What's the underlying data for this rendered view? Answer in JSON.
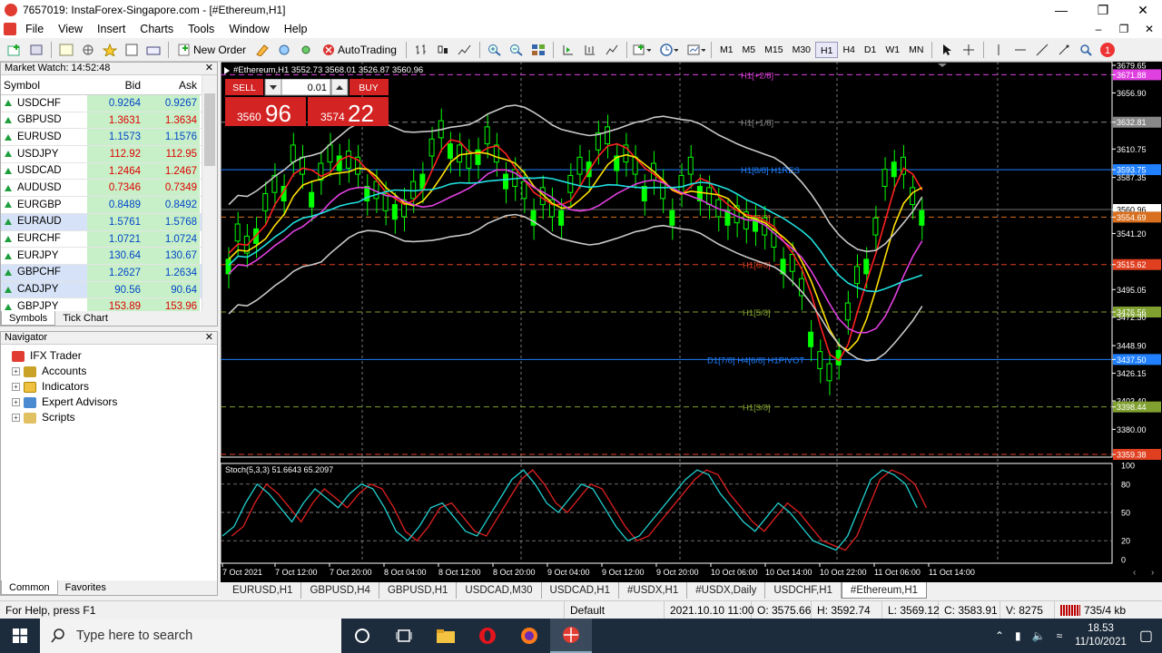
{
  "window": {
    "title": "7657019: InstaForex-Singapore.com - [#Ethereum,H1]"
  },
  "menu": [
    "File",
    "View",
    "Insert",
    "Charts",
    "Tools",
    "Window",
    "Help"
  ],
  "toolbar": {
    "new_order": "New Order",
    "autotrading": "AutoTrading",
    "timeframes": [
      "M1",
      "M5",
      "M15",
      "M30",
      "H1",
      "H4",
      "D1",
      "W1",
      "MN"
    ],
    "active_tf": "H1",
    "notify_count": "1"
  },
  "market_watch": {
    "title": "Market Watch: 14:52:48",
    "headers": [
      "Symbol",
      "Bid",
      "Ask"
    ],
    "rows": [
      {
        "symbol": "USDCHF",
        "bid": "0.9264",
        "ask": "0.9267",
        "color": "blue"
      },
      {
        "symbol": "GBPUSD",
        "bid": "1.3631",
        "ask": "1.3634",
        "color": "red"
      },
      {
        "symbol": "EURUSD",
        "bid": "1.1573",
        "ask": "1.1576",
        "color": "blue"
      },
      {
        "symbol": "USDJPY",
        "bid": "112.92",
        "ask": "112.95",
        "color": "red"
      },
      {
        "symbol": "USDCAD",
        "bid": "1.2464",
        "ask": "1.2467",
        "color": "red"
      },
      {
        "symbol": "AUDUSD",
        "bid": "0.7346",
        "ask": "0.7349",
        "color": "red"
      },
      {
        "symbol": "EURGBP",
        "bid": "0.8489",
        "ask": "0.8492",
        "color": "blue"
      },
      {
        "symbol": "EURAUD",
        "bid": "1.5761",
        "ask": "1.5768",
        "color": "blue"
      },
      {
        "symbol": "EURCHF",
        "bid": "1.0721",
        "ask": "1.0724",
        "color": "blue"
      },
      {
        "symbol": "EURJPY",
        "bid": "130.64",
        "ask": "130.67",
        "color": "blue"
      },
      {
        "symbol": "GBPCHF",
        "bid": "1.2627",
        "ask": "1.2634",
        "color": "blue"
      },
      {
        "symbol": "CADJPY",
        "bid": "90.56",
        "ask": "90.64",
        "color": "blue"
      },
      {
        "symbol": "GBPJPY",
        "bid": "153.89",
        "ask": "153.96",
        "color": "red"
      }
    ],
    "tabs": [
      "Symbols",
      "Tick Chart"
    ]
  },
  "navigator": {
    "title": "Navigator",
    "root": "IFX Trader",
    "items": [
      "Accounts",
      "Indicators",
      "Expert Advisors",
      "Scripts"
    ],
    "tabs": [
      "Common",
      "Favorites"
    ]
  },
  "chart": {
    "header": "#Ethereum,H1  3552.73 3568.01 3526.87 3560.96",
    "order": {
      "sell": "SELL",
      "buy": "BUY",
      "lots": "0.01",
      "sell_big": "96",
      "sell_small": "3560",
      "buy_big": "22",
      "buy_small": "3574"
    },
    "price_labels": [
      "3679.65",
      "3671.88",
      "3656.90",
      "3632.81",
      "3610.75",
      "3593.75",
      "3587.35",
      "3560.96",
      "3554.69",
      "3541.20",
      "3515.62",
      "3495.05",
      "3476.56",
      "3472.30",
      "3448.90",
      "3437.50",
      "3426.15",
      "3403.40",
      "3398.44",
      "3380.00",
      "3359.38"
    ],
    "murray": [
      "H1[+2/8]",
      "H1[+1/8]",
      "H1[8/8] H1RES",
      "H1[7/8]",
      "H1[6/8]",
      "H1[5/8]",
      "D1[7/8] H4[6/8] H1PIVOT",
      "H1[3/8]"
    ],
    "stoch_label": "Stoch(5,3,3) 51.6643 65.2097",
    "stoch_levels": [
      "100",
      "80",
      "50",
      "20",
      "0"
    ],
    "time_labels": [
      "7 Oct 2021",
      "7 Oct 12:00",
      "7 Oct 20:00",
      "8 Oct 04:00",
      "8 Oct 12:00",
      "8 Oct 20:00",
      "9 Oct 04:00",
      "9 Oct 12:00",
      "9 Oct 20:00",
      "10 Oct 06:00",
      "10 Oct 14:00",
      "10 Oct 22:00",
      "11 Oct 06:00",
      "11 Oct 14:00"
    ]
  },
  "chart_tabs": [
    "EURUSD,H1",
    "GBPUSD,H4",
    "GBPUSD,H1",
    "USDCAD,M30",
    "USDCAD,H1",
    "#USDX,H1",
    "#USDX,Daily",
    "USDCHF,H1",
    "#Ethereum,H1"
  ],
  "chart_tab_active": "#Ethereum,H1",
  "status": {
    "help": "For Help, press F1",
    "profile": "Default",
    "time": "2021.10.10 11:00",
    "open": "O: 3575.66",
    "high": "H: 3592.74",
    "low": "L: 3569.12",
    "close": "C: 3583.91",
    "volume": "V: 8275",
    "traffic": "735/4 kb"
  },
  "taskbar": {
    "search": "Type here to search",
    "time": "18.53",
    "date": "11/10/2021"
  },
  "colors": {
    "chart_bg": "#000000",
    "bull_candle": "#00ff00",
    "ma_red": "#ff2020",
    "ma_yellow": "#ffe000",
    "ma_magenta": "#e040e0",
    "ma_cyan": "#20e0e0",
    "envelope": "#c8c8c8",
    "stoch_main": "#20d0d0",
    "stoch_signal": "#e02020"
  }
}
